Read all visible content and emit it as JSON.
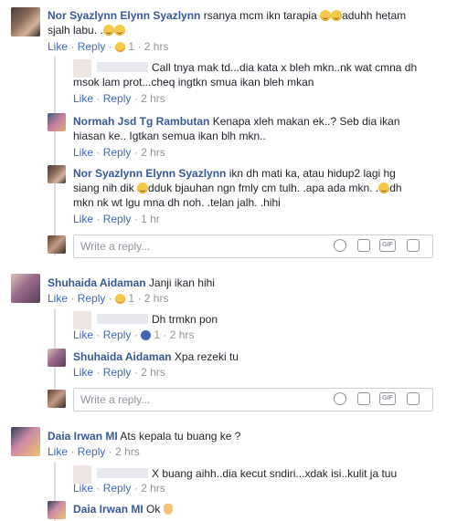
{
  "comments": [
    {
      "name": "Nor Syazlynn Elynn Syazlynn",
      "text1": " rsanya mcm ikn tarapia ",
      "text2": "aduhh hetam",
      "text3": "sjalh labu. .",
      "like": "Like",
      "reply": "Reply",
      "reactions": "1",
      "time": "2 hrs",
      "replies": [
        {
          "name": "",
          "text1": "Call tnya mak td...dia kata x bleh mkn..nk wat cmna dh",
          "text2": "msok lam prot...cheq ingtkn smua ikan bleh mkan",
          "like": "Like",
          "reply": "Reply",
          "time": "2 hrs"
        },
        {
          "name": "Normah Jsd Tg Rambutan",
          "text1": " Kenapa xleh makan ek..? Seb dia ikan",
          "text2": "hiasan ke.. Igtkan semua ikan blh mkn..",
          "like": "Like",
          "reply": "Reply",
          "time": "2 hrs"
        },
        {
          "name": "Nor Syazlynn Elynn Syazlynn",
          "text1": " ikn dh mati ka, atau hidup2 lagi hg",
          "text2a": "siang nih dik ",
          "text2b": "dduk bjauhan ngn fmly cm tulh. .apa ada mkn. .",
          "text2c": "dh",
          "text3": "mkn nk wt lgu mna dh noh. .telan jalh. .hihi",
          "like": "Like",
          "reply": "Reply",
          "time": "1 hr"
        }
      ],
      "reply_placeholder": "Write a reply..."
    },
    {
      "name": "Shuhaida Aidaman",
      "text1": " Janji ikan hihi",
      "like": "Like",
      "reply": "Reply",
      "reactions": "1",
      "time": "2 hrs",
      "replies": [
        {
          "name": "",
          "text1": "Dh trmkn pon",
          "like": "Like",
          "reply": "Reply",
          "reactions": "1",
          "time": "2 hrs"
        },
        {
          "name": "Shuhaida Aidaman",
          "text1": " Xpa rezeki tu",
          "like": "Like",
          "reply": "Reply",
          "time": "2 hrs"
        }
      ],
      "reply_placeholder": "Write a reply..."
    },
    {
      "name": "Daia Irwan MI",
      "text1": " Ats kepala tu buang ke ?",
      "like": "Like",
      "reply": "Reply",
      "time": "2 hrs",
      "replies": [
        {
          "name": "",
          "text1": "X buang aihh..dia kecut sndiri...xdak isi..kulit ja tuu",
          "like": "Like",
          "reply": "Reply",
          "time": "2 hrs"
        },
        {
          "name": "Daia Irwan MI",
          "text1": " Ok "
        }
      ]
    }
  ],
  "separator": "·",
  "toolbar_icons": [
    "emoji-icon",
    "camera-icon",
    "gif-icon",
    "sticker-icon"
  ]
}
